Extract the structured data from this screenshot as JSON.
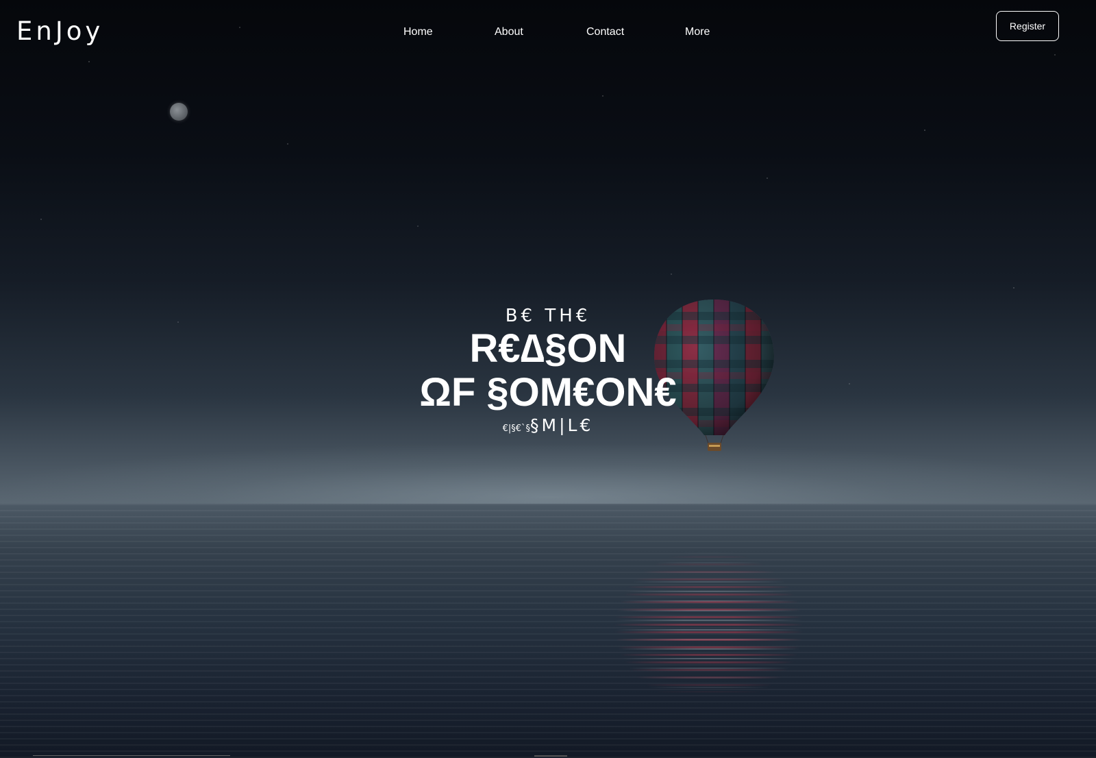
{
  "header": {
    "logo": "EnJoy",
    "nav": [
      "Home",
      "About",
      "Contact",
      "More"
    ],
    "register_label": "Register"
  },
  "hero": {
    "line1": "B€ TH€",
    "line2": "R€∆§ON",
    "line3": "ΩF §OM€ON€",
    "line4_small": "€|§€`§",
    "line4_word": "§M|L€"
  },
  "colors": {
    "background": "#05070b",
    "text": "#ffffff",
    "water": "#263240"
  },
  "icons": [
    "moon-icon",
    "hot-air-balloon-icon"
  ]
}
